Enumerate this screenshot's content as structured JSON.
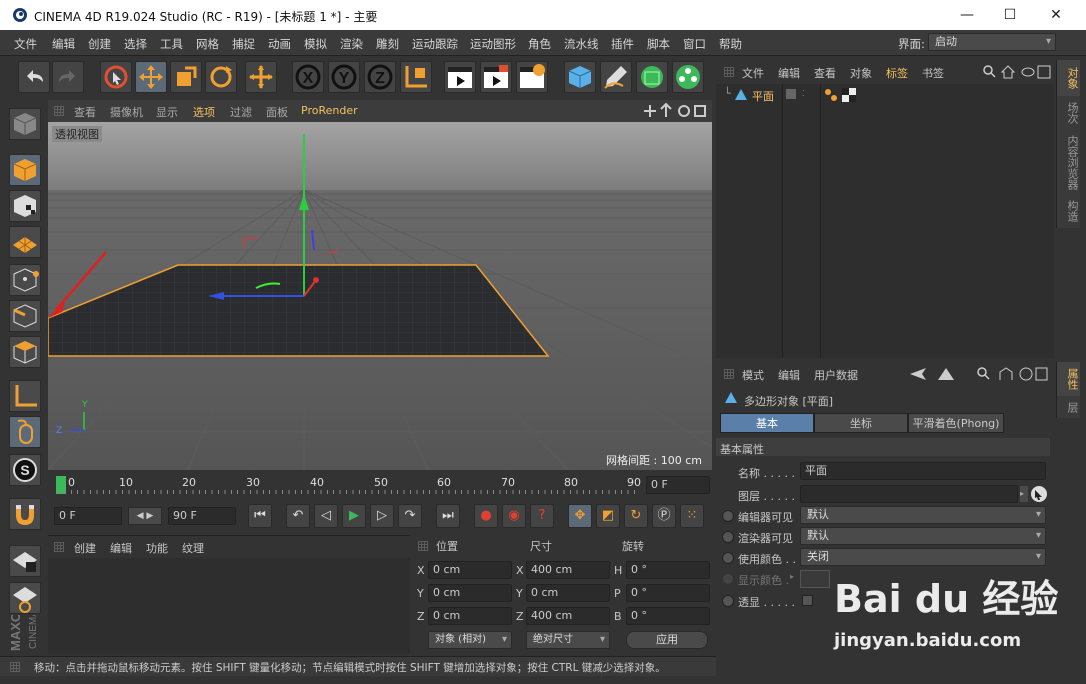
{
  "window": {
    "title": "CINEMA 4D R19.024 Studio (RC - R19) - [未标题 1 *] - 主要",
    "minimize": "—",
    "maximize": "☐",
    "close": "✕"
  },
  "menu": [
    "文件",
    "编辑",
    "创建",
    "选择",
    "工具",
    "网格",
    "捕捉",
    "动画",
    "模拟",
    "渲染",
    "雕刻",
    "运动跟踪",
    "运动图形",
    "角色",
    "流水线",
    "插件",
    "脚本",
    "窗口",
    "帮助"
  ],
  "layout": {
    "label": "界面:",
    "value": "启动"
  },
  "viewport": {
    "menu": [
      "查看",
      "摄像机",
      "显示",
      "选项",
      "过滤",
      "面板",
      "ProRender"
    ],
    "name": "透视视图",
    "grid_info": "网格间距 : 100 cm",
    "axis_labels": {
      "y": "Y",
      "z": "Z"
    }
  },
  "timeline": {
    "ticks": [
      "0",
      "10",
      "20",
      "30",
      "40",
      "50",
      "60",
      "70",
      "80",
      "90"
    ],
    "current": "0 F"
  },
  "playback": {
    "start": "0 F",
    "end": "90 F"
  },
  "material": {
    "tabs": [
      "创建",
      "编辑",
      "功能",
      "纹理"
    ]
  },
  "coords": {
    "headers": [
      "位置",
      "尺寸",
      "旋转"
    ],
    "rows": [
      {
        "a": "X",
        "pos": "0 cm",
        "b": "X",
        "size": "400 cm",
        "c": "H",
        "rot": "0 °"
      },
      {
        "a": "Y",
        "pos": "0 cm",
        "b": "Y",
        "size": "0 cm",
        "c": "P",
        "rot": "0 °"
      },
      {
        "a": "Z",
        "pos": "0 cm",
        "b": "Z",
        "size": "400 cm",
        "c": "B",
        "rot": "0 °"
      }
    ],
    "mode": "对象 (相对)",
    "size_mode": "绝对尺寸",
    "apply": "应用"
  },
  "status": "移动：点击并拖动鼠标移动元素。按住 SHIFT 键量化移动；节点编辑模式时按住 SHIFT 键增加选择对象；按住 CTRL 键减少选择对象。",
  "objects": {
    "tabs": [
      "文件",
      "编辑",
      "查看",
      "对象",
      "标签",
      "书签"
    ],
    "items": [
      {
        "name": "平面"
      }
    ]
  },
  "attributes": {
    "tabs": [
      "模式",
      "编辑",
      "用户数据"
    ],
    "object_title": "多边形对象 [平面]",
    "subtabs": [
      "基本",
      "坐标",
      "平滑着色(Phong)"
    ],
    "section": "基本属性",
    "fields": [
      {
        "label": "名称 . . . . .",
        "value": "平面"
      },
      {
        "label": "图层 . . . . .",
        "value": ""
      },
      {
        "label": "编辑器可见",
        "value": "默认"
      },
      {
        "label": "渲染器可见",
        "value": "默认"
      },
      {
        "label": "使用颜色 . .",
        "value": "关闭"
      },
      {
        "label": "显示颜色 .",
        "value": ""
      },
      {
        "label": "透显 . . . . .",
        "value": ""
      }
    ]
  },
  "side_tabs": {
    "top": [
      "对象",
      "场次",
      "内容浏览器",
      "构造"
    ],
    "bottom": [
      "属性",
      "层"
    ]
  },
  "watermark": {
    "brand": "Bai du 经验",
    "url": "jingyan.baidu.com"
  },
  "colors": {
    "accent": "#f0a030",
    "selected_tab": "#5a7fa8",
    "active_text": "#f5c060"
  }
}
